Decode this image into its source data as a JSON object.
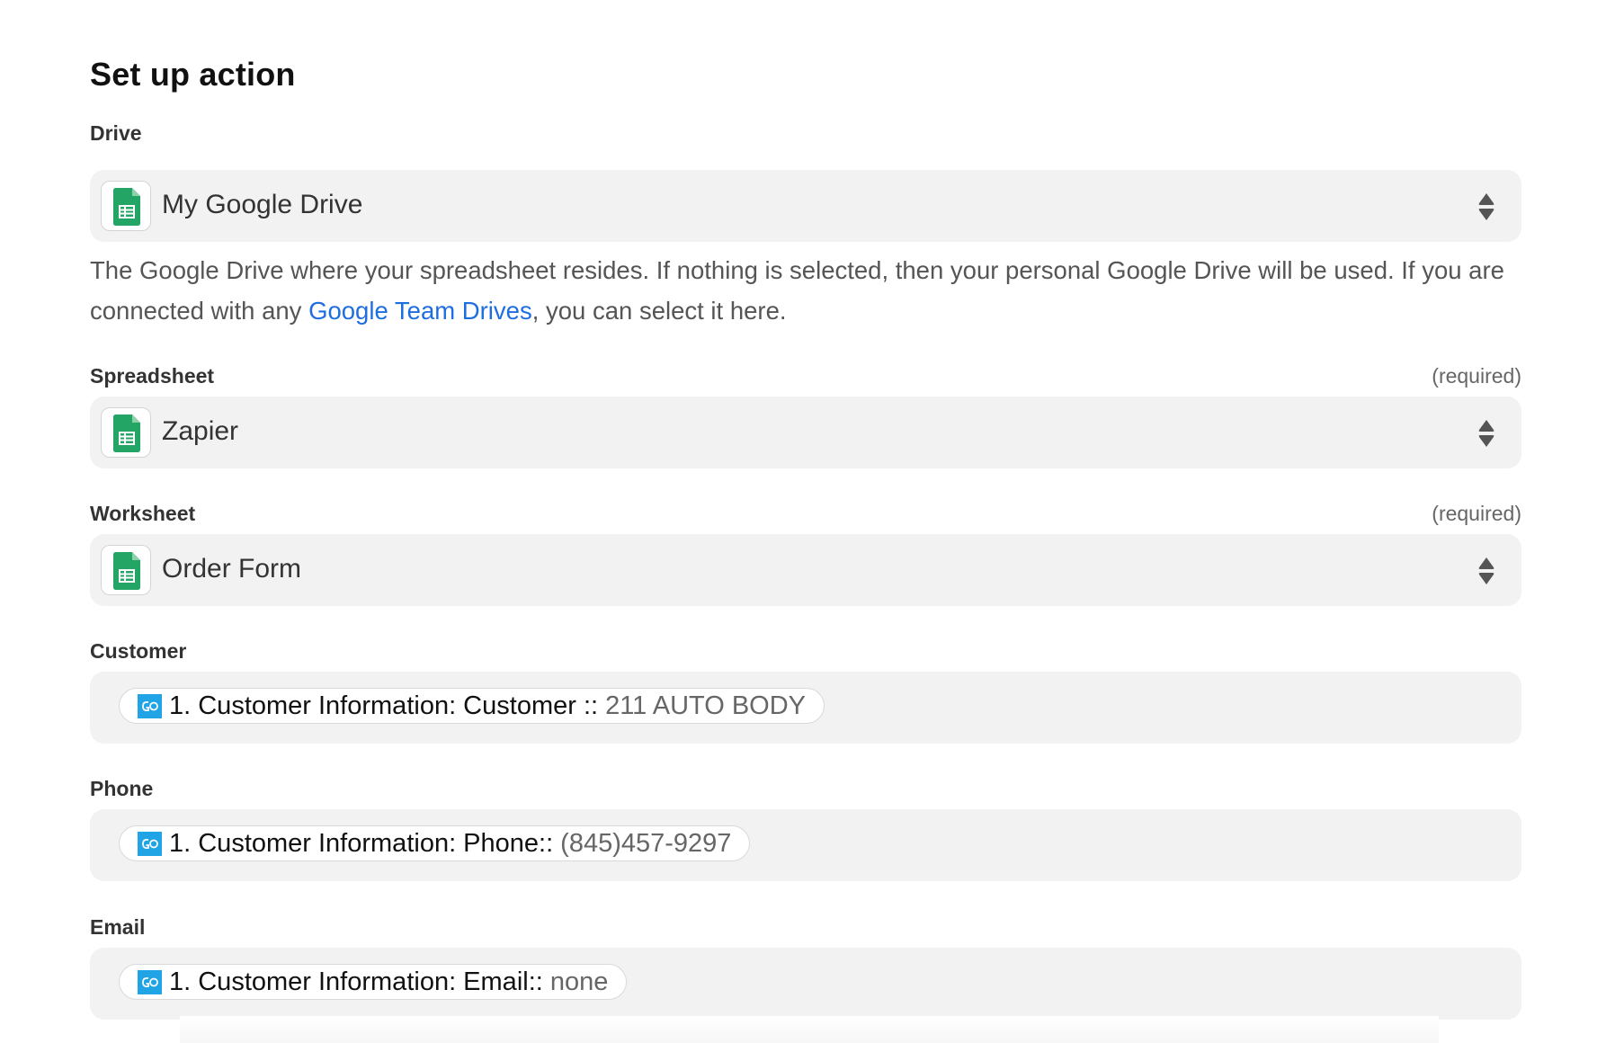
{
  "title": "Set up action",
  "drive": {
    "label": "Drive",
    "value": "My Google Drive",
    "help_text_before": "The Google Drive where your spreadsheet resides. If nothing is selected, then your personal Google Drive will be used. If you are connected with any ",
    "help_link": "Google Team Drives",
    "help_text_after": ", you can select it here."
  },
  "spreadsheet": {
    "label": "Spreadsheet",
    "required": "(required)",
    "value": "Zapier"
  },
  "worksheet": {
    "label": "Worksheet",
    "required": "(required)",
    "value": "Order Form"
  },
  "customer": {
    "label": "Customer",
    "pill_key": "1. Customer Information: Customer ::",
    "pill_value": "211 AUTO BODY"
  },
  "phone": {
    "label": "Phone",
    "pill_key": "1. Customer Information: Phone::",
    "pill_value": "(845)457-9297"
  },
  "email": {
    "label": "Email",
    "pill_key": "1. Customer Information: Email::",
    "pill_value": "none"
  },
  "icons": {
    "app_icon": "google-sheets-icon",
    "sort_icon": "sort-up-down-icon",
    "pill_icon": "formstack-icon"
  },
  "colors": {
    "sheets_green": "#23a566",
    "link_blue": "#1f6ee0",
    "pill_icon_blue": "#20a4e6",
    "field_bg": "#f2f2f2"
  }
}
